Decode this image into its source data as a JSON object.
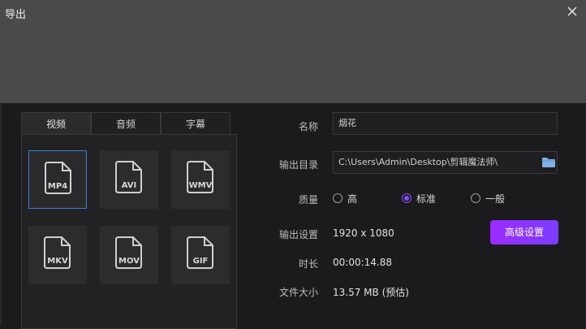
{
  "window": {
    "title": "导出"
  },
  "format_tabs": {
    "video": "视频",
    "audio": "音频",
    "subtitle": "字幕"
  },
  "formats": [
    "MP4",
    "AVI",
    "WMV",
    "MKV",
    "MOV",
    "GIF"
  ],
  "selected_format": "MP4",
  "settings": {
    "name_label": "名称",
    "name_value": "烟花",
    "output_dir_label": "输出目录",
    "output_dir_value": "C:\\Users\\Admin\\Desktop\\剪辑魔法师\\",
    "quality_label": "质量",
    "quality_options": [
      "高",
      "标准",
      "一般"
    ],
    "quality_selected": "标准",
    "output_settings_label": "输出设置",
    "resolution": "1920 x 1080",
    "advanced_button": "高级设置",
    "duration_label": "时长",
    "duration_value": "00:00:14.88",
    "filesize_label": "文件大小",
    "filesize_value": "13.57 MB (预估)"
  },
  "colors": {
    "accent": "#8a4dff",
    "selection_border": "#3b7cdb",
    "button_gradient_start": "#9b2cff",
    "button_gradient_end": "#7b3dff"
  },
  "icons": {
    "close": "close-icon",
    "folder": "folder-icon",
    "file": "file-icon"
  }
}
